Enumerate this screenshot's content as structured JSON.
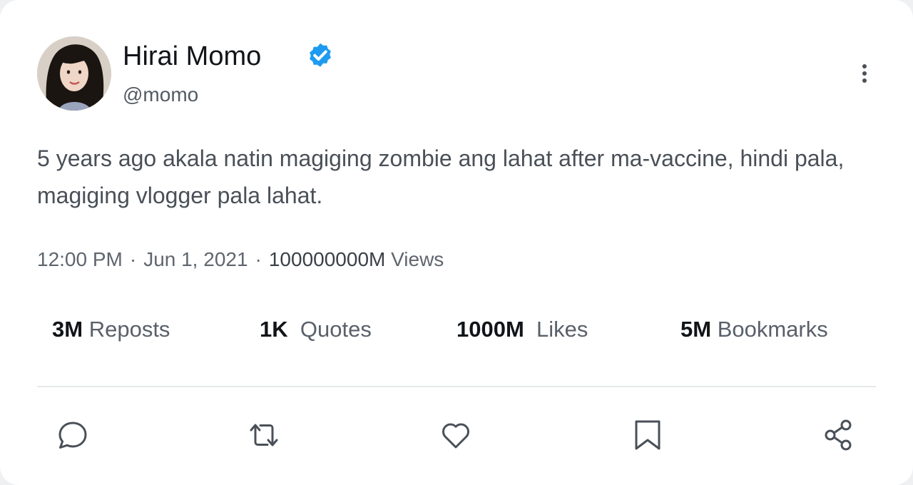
{
  "author": {
    "display_name": "Hirai Momo",
    "handle": "@momo",
    "verified": true,
    "avatar_icon": "user-avatar"
  },
  "post": {
    "text": "5 years ago akala natin magiging zombie ang lahat after ma-vaccine, hindi pala, magiging vlogger pala lahat."
  },
  "meta": {
    "time": "12:00 PM",
    "separator": "·",
    "date": "Jun 1, 2021",
    "views_count": "100000000M",
    "views_label": "Views"
  },
  "stats": [
    {
      "count": "3M",
      "label": "Reposts"
    },
    {
      "count": "1K",
      "label": "Quotes"
    },
    {
      "count": "1000M",
      "label": "Likes"
    },
    {
      "count": "5M",
      "label": "Bookmarks"
    }
  ],
  "actions": [
    "reply-icon",
    "repost-icon",
    "like-icon",
    "bookmark-icon",
    "share-icon"
  ],
  "colors": {
    "verified_badge": "#1d9bf0",
    "text_primary": "#111418",
    "text_secondary": "#545b63",
    "icon": "#4a5058",
    "divider": "#e6e8ea"
  }
}
